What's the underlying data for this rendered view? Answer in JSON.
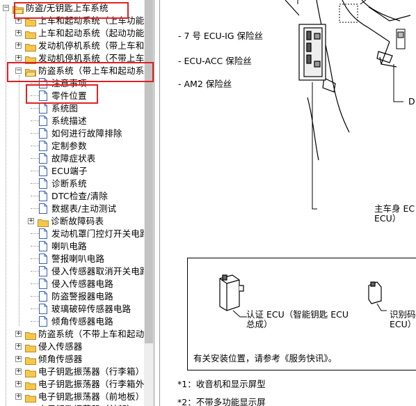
{
  "tree": {
    "items": [
      {
        "label": "防盗/无钥匙上车系统",
        "expander": "−",
        "type": "folder",
        "open": true
      },
      {
        "label": "上车和起动系统（上车功能",
        "expander": "+",
        "type": "folder"
      },
      {
        "label": "上车和起动系统（起动功能",
        "expander": "+",
        "type": "folder"
      },
      {
        "label": "发动机停机系统（带上车和",
        "expander": "+",
        "type": "folder"
      },
      {
        "label": "发动机停机系统（不带上车",
        "expander": "+",
        "type": "folder"
      },
      {
        "label": "防盗系统（带上车和起动系",
        "expander": "−",
        "type": "folder",
        "open": true
      },
      {
        "label": "注意事项",
        "type": "page"
      },
      {
        "label": "零件位置",
        "type": "page"
      },
      {
        "label": "系统图",
        "type": "page"
      },
      {
        "label": "系统描述",
        "type": "page"
      },
      {
        "label": "如何进行故障排除",
        "type": "page"
      },
      {
        "label": "定制参数",
        "type": "page"
      },
      {
        "label": "故障症状表",
        "type": "page"
      },
      {
        "label": "ECU端子",
        "type": "page"
      },
      {
        "label": "诊断系统",
        "type": "page"
      },
      {
        "label": "DTC检查/清除",
        "type": "page"
      },
      {
        "label": "数据表/主动测试",
        "type": "page"
      },
      {
        "label": "诊断故障码表",
        "expander": "+",
        "type": "folder"
      },
      {
        "label": "发动机罩门控灯开关电路",
        "type": "page"
      },
      {
        "label": "喇叭电路",
        "type": "page"
      },
      {
        "label": "警报喇叭电路",
        "type": "page"
      },
      {
        "label": "侵入传感器取消开关电路",
        "type": "page"
      },
      {
        "label": "侵入传感器电路",
        "type": "page"
      },
      {
        "label": "防盗警报器电路",
        "type": "page"
      },
      {
        "label": "玻璃破碎传感器电路",
        "type": "page"
      },
      {
        "label": "倾角传感器电路",
        "type": "page"
      },
      {
        "label": "防盗系统（不带上车和起动",
        "expander": "+",
        "type": "folder"
      },
      {
        "label": "侵入传感器",
        "expander": "+",
        "type": "folder"
      },
      {
        "label": "倾角传感器",
        "expander": "+",
        "type": "folder"
      },
      {
        "label": "电子钥匙振荡器（行李箱）",
        "expander": "+",
        "type": "folder"
      },
      {
        "label": "电子钥匙振荡器（行李箱外",
        "expander": "+",
        "type": "folder"
      },
      {
        "label": "电子钥匙振荡器（前地板）",
        "expander": "+",
        "type": "folder"
      },
      {
        "label": "电子钥匙振荡器（前部）",
        "expander": "+",
        "type": "folder"
      }
    ]
  },
  "doc": {
    "fuse1": "- 7 号 ECU-IG 保险丝",
    "fuse2": "- ECU-ACC 保险丝",
    "fuse3": "- AM2 保险丝",
    "callout_d": "D",
    "main_body_line1": "主车身 EC",
    "main_body_line2": "ECU）",
    "cert_ecu_line1": "认证 ECU（智能钥匙 ECU",
    "cert_ecu_line2": "总成）",
    "id_line1": "识别码",
    "id_line2": "ECU）",
    "install_note": "有关安装位置，请参考《服务快讯》。",
    "footnote1": "*1：收音机和显示屏型",
    "footnote2": "*2：不带多功能显示屏"
  },
  "colors": {
    "highlight": "#e02020",
    "folder": "#f4c84a",
    "scrollbar": "#c3c3c3"
  }
}
